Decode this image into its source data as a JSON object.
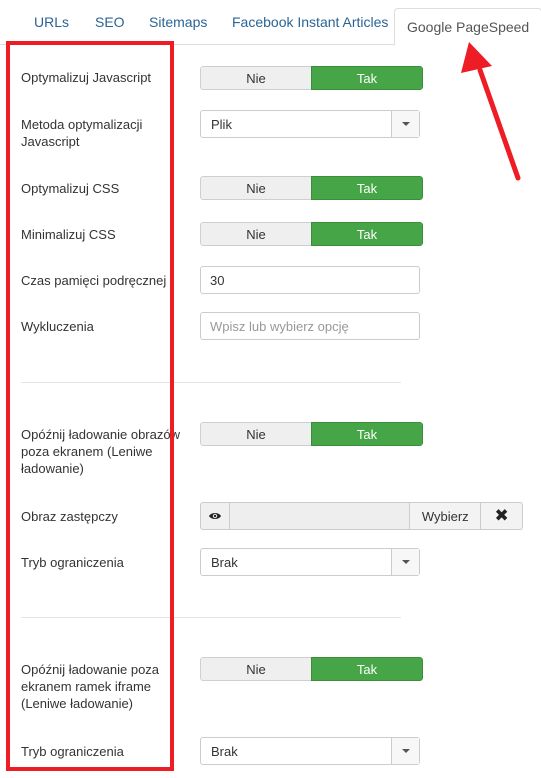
{
  "tabs": [
    {
      "label": "URLs"
    },
    {
      "label": "SEO"
    },
    {
      "label": "Sitemaps"
    },
    {
      "label": "Facebook Instant Articles"
    },
    {
      "label": "Google PageSpeed"
    }
  ],
  "toggle": {
    "no": "Nie",
    "yes": "Tak"
  },
  "fields": {
    "optimize_js": {
      "label": "Optymalizuj Javascript",
      "value": "Tak"
    },
    "js_method": {
      "label": "Metoda optymalizacji Javascript",
      "value": "Plik"
    },
    "optimize_css": {
      "label": "Optymalizuj CSS",
      "value": "Tak"
    },
    "minify_css": {
      "label": "Minimalizuj CSS",
      "value": "Tak"
    },
    "cache_time": {
      "label": "Czas pamięci podręcznej",
      "value": "30"
    },
    "exclusions": {
      "label": "Wykluczenia",
      "placeholder": "Wpisz lub wybierz opcję"
    },
    "lazy_images": {
      "label": "Opóźnij ładowanie obrazów poza ekranem (Leniwe ładowanie)",
      "value": "Tak"
    },
    "placeholder_image": {
      "label": "Obraz zastępczy",
      "pick": "Wybierz",
      "clear": "✖",
      "icon": "eye-icon"
    },
    "restriction_mode_1": {
      "label": "Tryb ograniczenia",
      "value": "Brak"
    },
    "lazy_iframes": {
      "label": "Opóźnij ładowanie poza ekranem ramek iframe (Leniwe ładowanie)",
      "value": "Tak"
    },
    "restriction_mode_2": {
      "label": "Tryb ograniczenia",
      "value": "Brak"
    }
  },
  "colors": {
    "active_toggle": "#46a546",
    "annotation": "#ee1c25",
    "tab_link": "#2a6496"
  }
}
